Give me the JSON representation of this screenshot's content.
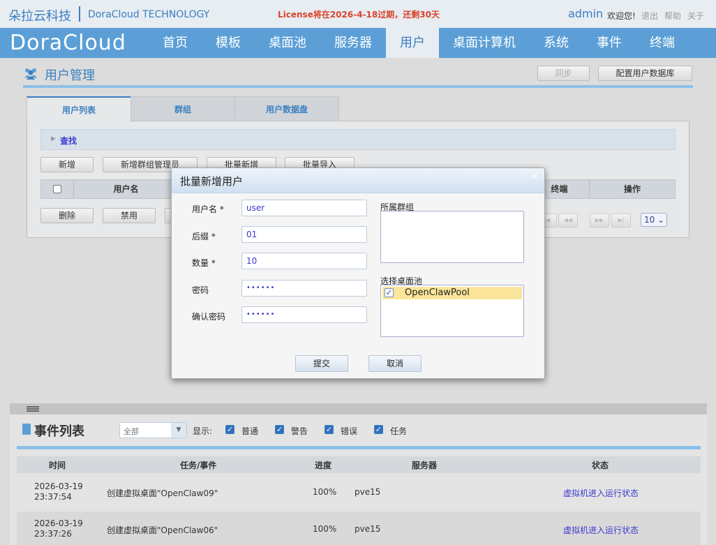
{
  "header": {
    "brand_cn": "朵拉云科技",
    "brand_en": "DoraCloud TECHNOLOGY",
    "license_notice": "License将在2026-4-18过期，还剩30天",
    "username": "admin",
    "welcome": "欢迎您!",
    "logout": "退出",
    "help": "帮助",
    "about": "关于"
  },
  "nav": {
    "logo": "DoraCloud",
    "items": [
      "首页",
      "模板",
      "桌面池",
      "服务器",
      "用户",
      "桌面计算机",
      "系统",
      "事件",
      "终端"
    ],
    "active": "用户"
  },
  "page": {
    "title": "用户管理",
    "sync_button": "同步",
    "config_db_button": "配置用户数据库",
    "tabs": [
      "用户列表",
      "群组",
      "用户数据盘"
    ],
    "search_label": "查找",
    "toolbar": [
      "新增",
      "新增群组管理员",
      "批量新增",
      "批量导入"
    ],
    "grid_columns": [
      "用户名",
      "终端",
      "操作"
    ],
    "row_actions": [
      "删除",
      "禁用"
    ],
    "page_size": "10"
  },
  "modal": {
    "title": "批量新增用户",
    "close": "×",
    "fields": {
      "username_label": "用户名 *",
      "username_value": "user",
      "suffix_label": "后缀 *",
      "suffix_value": "01",
      "count_label": "数量 *",
      "count_value": "10",
      "password_label": "密码",
      "password_value": "••••••",
      "confirm_label": "确认密码",
      "confirm_value": "••••••"
    },
    "group_label": "所属群组",
    "pool_label": "选择桌面池",
    "pools": [
      {
        "name": "OpenClawPool",
        "checked": true
      }
    ],
    "submit": "提交",
    "cancel": "取消"
  },
  "events": {
    "title": "事件列表",
    "filter_selected": "全部",
    "show_label": "显示:",
    "filters": [
      "普通",
      "警告",
      "错误",
      "任务"
    ],
    "columns": [
      "时间",
      "任务/事件",
      "进度",
      "服务器",
      "状态"
    ],
    "rows": [
      {
        "date": "2026-03-19",
        "time": "23:37:54",
        "task": "创建虚拟桌面\"OpenClaw09\"",
        "progress": "100%",
        "server": "pve15",
        "status": "虚拟机进入运行状态"
      },
      {
        "date": "2026-03-19",
        "time": "23:37:26",
        "task": "创建虚拟桌面\"OpenClaw06\"",
        "progress": "100%",
        "server": "pve15",
        "status": "虚拟机进入运行状态"
      }
    ]
  },
  "colors": {
    "nav_blue": "#5b9fd6",
    "accent": "#3a7fc0",
    "license_red": "#d9432d",
    "selected_row": "#fbe59a"
  }
}
